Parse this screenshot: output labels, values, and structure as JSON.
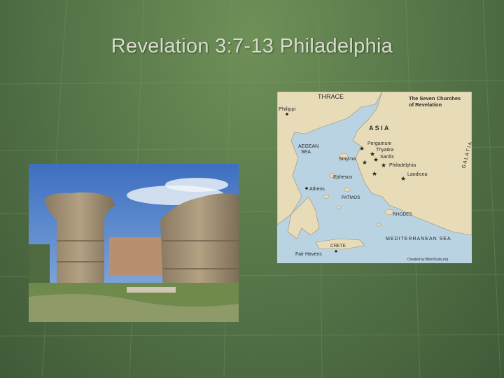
{
  "slide": {
    "title": "Revelation 3:7-13 Philadelphia"
  },
  "photo": {
    "subject": "ruins-of-philadelphia-pillars"
  },
  "map": {
    "legend_line1": "The Seven Churches",
    "legend_line2": "of Revelation",
    "credit": "Created by BibleStudy.org",
    "labels": {
      "thrace": "THRACE",
      "philippi": "Philippi",
      "asia": "A S I A",
      "galatia": "G A L A T I A",
      "aegean1": "AEGEAN",
      "aegean2": "SEA",
      "pergamum": "Pergamum",
      "thyatira": "Thyatira",
      "sardis": "Sardis",
      "smyrna": "Smyrna",
      "philadelphia": "Philadelphia",
      "laodicea": "Laodicea",
      "ephesus": "Ephesus",
      "athens": "Athens",
      "patmos": "PATMOS",
      "rhodes": "RHODES",
      "mediterranean": "MEDITERRANEAN SEA",
      "crete": "CRETE",
      "fair_havens": "Fair Havens"
    }
  },
  "colors": {
    "background": "#58784a",
    "title": "#d7dccb",
    "sea": "#b9d3e3",
    "land": "#e8dcb8"
  }
}
